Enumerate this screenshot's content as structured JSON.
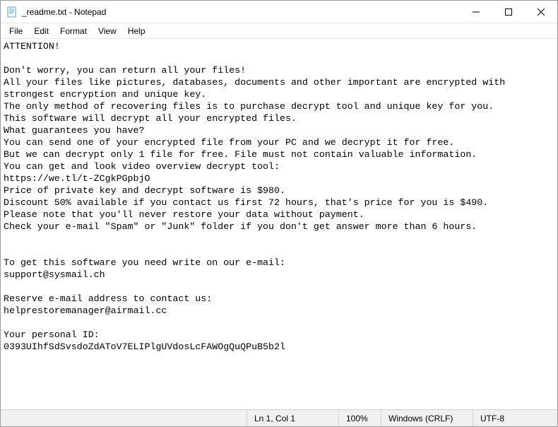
{
  "titlebar": {
    "title": "_readme.txt - Notepad"
  },
  "menubar": {
    "items": [
      "File",
      "Edit",
      "Format",
      "View",
      "Help"
    ]
  },
  "editor": {
    "text": "ATTENTION!\n\nDon't worry, you can return all your files!\nAll your files like pictures, databases, documents and other important are encrypted with strongest encryption and unique key.\nThe only method of recovering files is to purchase decrypt tool and unique key for you.\nThis software will decrypt all your encrypted files.\nWhat guarantees you have?\nYou can send one of your encrypted file from your PC and we decrypt it for free.\nBut we can decrypt only 1 file for free. File must not contain valuable information.\nYou can get and look video overview decrypt tool:\nhttps://we.tl/t-ZCgkPGpbjO\nPrice of private key and decrypt software is $980.\nDiscount 50% available if you contact us first 72 hours, that's price for you is $490.\nPlease note that you'll never restore your data without payment.\nCheck your e-mail \"Spam\" or \"Junk\" folder if you don't get answer more than 6 hours.\n\n\nTo get this software you need write on our e-mail:\nsupport@sysmail.ch\n\nReserve e-mail address to contact us:\nhelprestoremanager@airmail.cc\n\nYour personal ID:\n0393UIhfSdSvsdoZdAToV7ELIPlgUVdosLcFAWOgQuQPuB5b2l"
  },
  "statusbar": {
    "position": "Ln 1, Col 1",
    "zoom": "100%",
    "line_ending": "Windows (CRLF)",
    "encoding": "UTF-8"
  }
}
